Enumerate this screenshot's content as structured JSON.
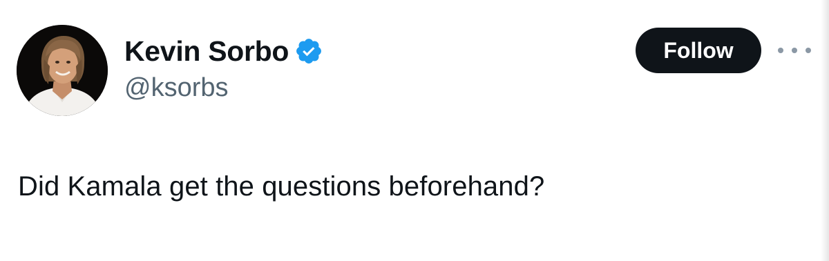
{
  "author": {
    "display_name": "Kevin Sorbo",
    "handle": "@ksorbs",
    "verified": true,
    "avatar_icon": "profile-photo",
    "verified_icon": "verified-badge-icon"
  },
  "actions": {
    "follow_label": "Follow",
    "more_icon": "more-options-icon"
  },
  "tweet": {
    "text": "Did Kamala get the questions beforehand?"
  },
  "colors": {
    "text_primary": "#0f1419",
    "text_secondary": "#536471",
    "verified_blue": "#1d9bf0",
    "follow_bg": "#0f1419",
    "follow_text": "#ffffff"
  }
}
